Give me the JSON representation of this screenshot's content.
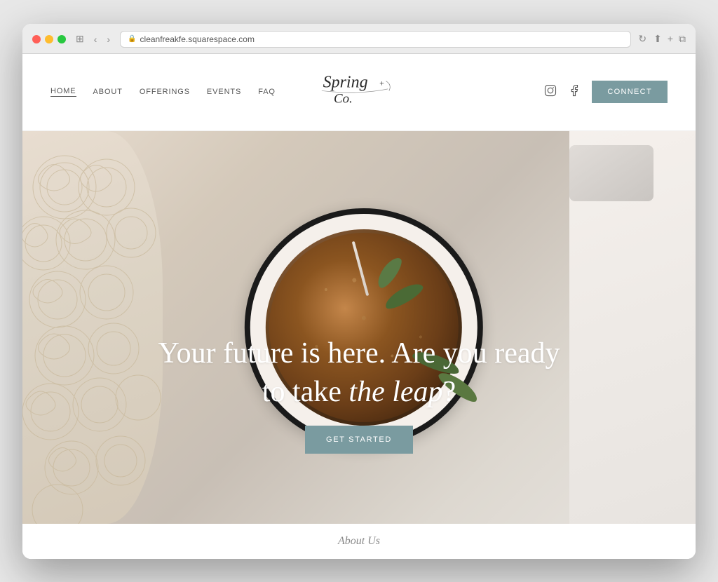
{
  "browser": {
    "url": "cleanfreakfe.squarespace.com",
    "reload_label": "↻"
  },
  "header": {
    "nav": {
      "home": "HOME",
      "about": "ABOUT",
      "offerings": "OFFERINGS",
      "events": "EVENTS",
      "faq": "FAQ"
    },
    "logo_text": "Spring + Co.",
    "connect_button": "CONNeCT"
  },
  "hero": {
    "headline_line1": "Your future is here. Are you ready",
    "headline_line2_plain": "to take ",
    "headline_line2_italic": "the leap",
    "headline_line2_end": "?",
    "cta_button": "GET STARTED"
  },
  "footer_teaser": {
    "label": "About Us"
  },
  "colors": {
    "connect_bg": "#7a9ba0",
    "get_started_bg": "#7a9ba0",
    "nav_text": "#555555",
    "accent": "#7a9ba0"
  }
}
